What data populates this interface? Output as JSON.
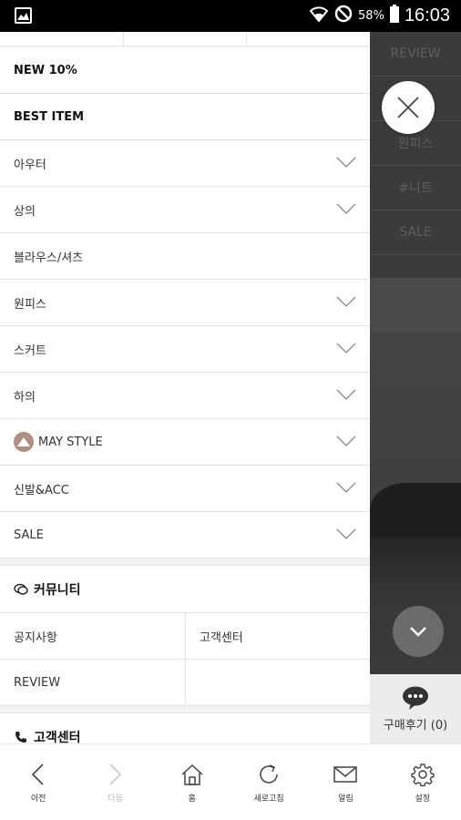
{
  "status_bar": {
    "battery": "58%",
    "time": "16:03"
  },
  "menu": {
    "items": [
      {
        "label": "NEW 10%",
        "bold": true,
        "expandable": false
      },
      {
        "label": "BEST ITEM",
        "bold": true,
        "expandable": false
      },
      {
        "label": "아우터",
        "expandable": true
      },
      {
        "label": "상의",
        "expandable": true
      },
      {
        "label": "블라우스/셔츠",
        "expandable": false
      },
      {
        "label": "원피스",
        "expandable": true
      },
      {
        "label": "스커트",
        "expandable": true
      },
      {
        "label": "하의",
        "expandable": true
      },
      {
        "label": "MAY STYLE",
        "expandable": true,
        "avatar": true
      },
      {
        "label": "신발&ACC",
        "expandable": true
      },
      {
        "label": "SALE",
        "expandable": true
      }
    ],
    "community": {
      "title": "커뮤니티",
      "links": [
        "공지사항",
        "고객센터",
        "REVIEW",
        ""
      ]
    },
    "customer_center": {
      "title": "고객센터"
    }
  },
  "background_menu": [
    "REVIEW",
    "",
    "원피스",
    "#니트",
    "SALE"
  ],
  "review_box": {
    "label": "구매후기 (0)"
  },
  "bottom_nav": [
    {
      "label": "이전",
      "icon": "back-icon",
      "disabled": false
    },
    {
      "label": "다음",
      "icon": "forward-icon",
      "disabled": true
    },
    {
      "label": "홈",
      "icon": "home-icon",
      "disabled": false
    },
    {
      "label": "새로고침",
      "icon": "refresh-icon",
      "disabled": false
    },
    {
      "label": "알림",
      "icon": "mail-icon",
      "disabled": false
    },
    {
      "label": "설정",
      "icon": "gear-icon",
      "disabled": false
    }
  ]
}
